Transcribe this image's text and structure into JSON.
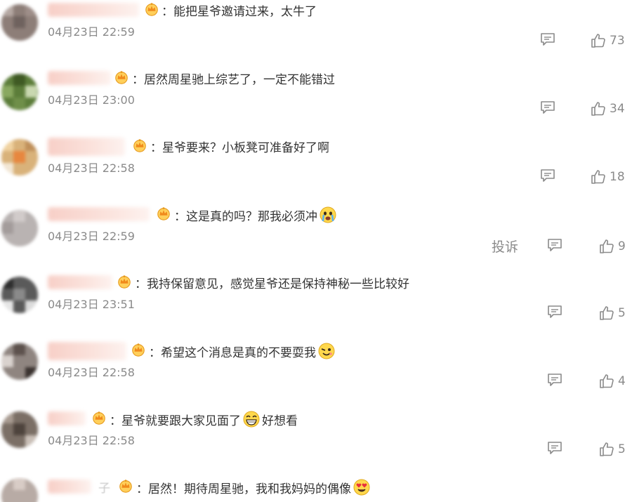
{
  "comments": [
    {
      "separator": "：",
      "text": "能把星爷邀请过来，太牛了",
      "date": "04月23日 22:59",
      "likes": "73"
    },
    {
      "separator": "：",
      "text": "居然周星驰上综艺了，一定不能错过",
      "date": "04月23日 23:00",
      "likes": "34"
    },
    {
      "separator": "：",
      "text": "星爷要来？小板凳可准备好了啊",
      "date": "04月23日 22:58",
      "likes": "18"
    },
    {
      "separator": "：",
      "text": "这是真的吗？那我必须冲",
      "date": "04月23日 22:59",
      "likes": "9",
      "report": "投诉"
    },
    {
      "separator": "：",
      "text": "我持保留意见，感觉星爷还是保持神秘一些比较好",
      "date": "04月23日 23:51",
      "likes": "5"
    },
    {
      "separator": "：",
      "text": "希望这个消息是真的不要耍我",
      "date": "04月23日 22:58",
      "likes": "4"
    },
    {
      "separator": "：",
      "text_a": "星爷就要跟大家见面了",
      "text_b": "好想看",
      "date": "04月23日 22:58",
      "likes": "5"
    },
    {
      "separator": "：",
      "text": "居然！期待周星驰，我和我妈妈的偶像",
      "name_tail": "子"
    }
  ],
  "icons": {
    "reply": "comment-icon",
    "like": "thumbs-up-icon",
    "badge": "crown-badge-icon"
  },
  "colors": {
    "text": "#333333",
    "meta": "#8a8a8a",
    "badge": "#f5a623"
  }
}
